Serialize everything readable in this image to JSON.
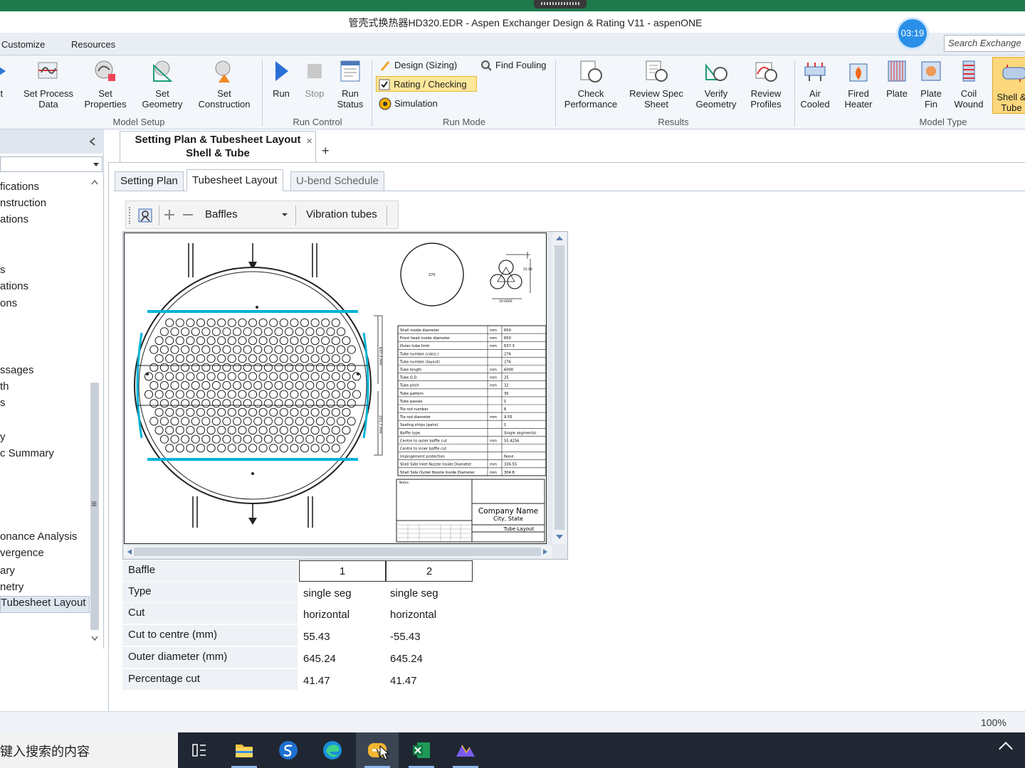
{
  "window": {
    "title": "管壳式换热器HD320.EDR - Aspen Exchanger Design & Rating V11 - aspenONE",
    "timer": "03:19"
  },
  "menu": {
    "items": [
      "Customize",
      "Resources"
    ],
    "search_placeholder": "Search Exchange"
  },
  "ribbon": {
    "model_setup": {
      "label": "Model Setup",
      "buttons": [
        "xt",
        "Set Process\nData",
        "Set\nProperties",
        "Set\nGeometry",
        "Set\nConstruction"
      ]
    },
    "run_control": {
      "label": "Run Control",
      "buttons": [
        "Run",
        "Stop",
        "Run\nStatus"
      ]
    },
    "run_mode": {
      "label": "Run Mode",
      "design": "Design (Sizing)",
      "rating": "Rating / Checking",
      "simulation": "Simulation",
      "find_fouling": "Find Fouling"
    },
    "results": {
      "label": "Results",
      "buttons": [
        "Check\nPerformance",
        "Review Spec\nSheet",
        "Verify\nGeometry",
        "Review\nProfiles"
      ]
    },
    "model_type": {
      "label": "Model Type",
      "buttons": [
        "Air\nCooled",
        "Fired\nHeater",
        "Plate",
        "Plate\nFin",
        "Coil\nWound",
        "Shell &\nTube"
      ]
    }
  },
  "nav": {
    "items": [
      "fications",
      "nstruction",
      "ations",
      "s",
      "ations",
      "ons",
      "ssages",
      "th",
      "s",
      "y",
      "c Summary",
      "onance Analysis",
      "vergence",
      "ary",
      "netry",
      "Tubesheet Layout"
    ],
    "active_index": 15
  },
  "doc_tab": {
    "line1": "Setting Plan & Tubesheet Layout",
    "line2": "Shell & Tube",
    "close": "×",
    "add": "+"
  },
  "sub_tabs": [
    "Setting Plan",
    "Tubesheet Layout",
    "U-bend Schedule"
  ],
  "toolbar": {
    "dropdown": "Baffles",
    "vibration": "Vibration tubes"
  },
  "drawing": {
    "circle_label": "270",
    "pitch_dims": [
      "25.00",
      "10.0000"
    ],
    "spec_rows": [
      [
        "Shell inside diameter",
        "mm",
        "650"
      ],
      [
        "Front head inside diameter",
        "mm",
        "650"
      ],
      [
        "Outer tube limit",
        "mm",
        "637.3"
      ],
      [
        "Tube number (calcs.)",
        "",
        "276"
      ],
      [
        "Tube number (layout)",
        "",
        "276"
      ],
      [
        "Tube length",
        "mm",
        "6000"
      ],
      [
        "Tube O.D.",
        "mm",
        "25"
      ],
      [
        "Tube pitch",
        "mm",
        "32"
      ],
      [
        "Tube pattern",
        "",
        "30"
      ],
      [
        "Tube passes",
        "",
        "1"
      ],
      [
        "Tie rod number",
        "",
        "6"
      ],
      [
        "Tie rod diameter",
        "mm",
        "9.55"
      ],
      [
        "Sealing strips (pairs)",
        "",
        "1"
      ],
      [
        "Baffle type",
        "",
        "Single segmental"
      ],
      [
        "Centre to outer baffle cut",
        "mm",
        "55.4256"
      ],
      [
        "Centre to inner baffle cut",
        "",
        ""
      ],
      [
        "Impingement protection",
        "",
        "None"
      ],
      [
        "Shell Side Inlet Nozzle Inside Diameter",
        "mm",
        "336.55"
      ],
      [
        "Shell Side Outlet Nozzle Inside Diameter",
        "mm",
        "304.8"
      ]
    ],
    "notes_label": "Notes",
    "company": "Company Name",
    "city": "City, State",
    "sheet_title": "Tube Layout",
    "dim_label_1": "637.3 mm",
    "dim_label_2": "221.7 mm"
  },
  "baffle_table": {
    "header": {
      "label": "Baffle",
      "c1": "1",
      "c2": "2"
    },
    "rows": [
      {
        "label": "Type",
        "c1": "single seg",
        "c2": "single seg"
      },
      {
        "label": "Cut",
        "c1": "horizontal",
        "c2": "horizontal"
      },
      {
        "label": "Cut to centre (mm)",
        "c1": "55.43",
        "c2": "-55.43"
      },
      {
        "label": "Outer diameter (mm)",
        "c1": "645.24",
        "c2": "645.24"
      },
      {
        "label": "Percentage cut",
        "c1": "41.47",
        "c2": "41.47"
      }
    ]
  },
  "status": {
    "zoom": "100%"
  },
  "taskbar": {
    "search": "键入搜索的内容"
  },
  "colors": {
    "accent": "#2a8fe8",
    "selected": "#fde79a",
    "baffle_cut": "#00b4d8",
    "taskbar": "#202733"
  }
}
